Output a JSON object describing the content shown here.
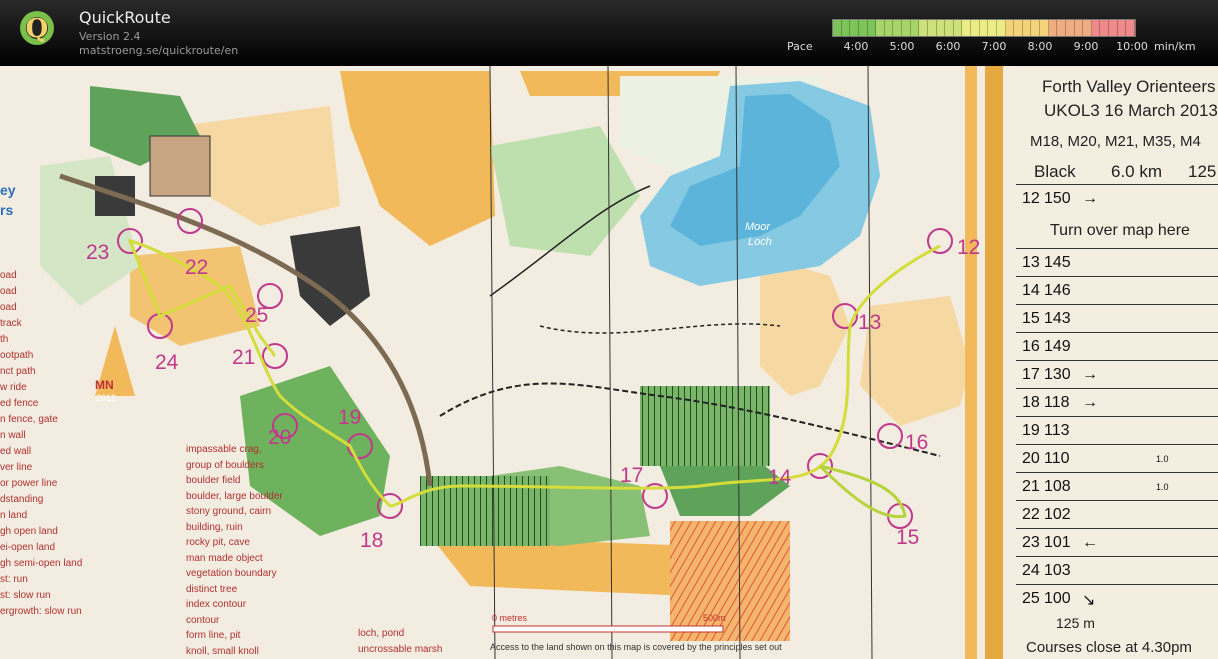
{
  "app": {
    "title": "QuickRoute",
    "version": "Version 2.4",
    "url": "matstroeng.se/quickroute/en",
    "logo_icon": "quickroute-logo-icon"
  },
  "pace": {
    "label": "Pace",
    "ticks": [
      "4:00",
      "5:00",
      "6:00",
      "7:00",
      "8:00",
      "9:00",
      "10:00"
    ],
    "unit": "min/km",
    "colors": [
      "#7cc35a",
      "#a7d56a",
      "#cde07a",
      "#ecec85",
      "#f3d27a",
      "#f0ac82",
      "#f08a8a"
    ]
  },
  "map": {
    "lake_name_1": "Moor",
    "lake_name_2": "Loch",
    "mn_label": "MN",
    "mn_year": "2012",
    "scale_label": "0 metres",
    "scale_end": "500m",
    "access_text": "Access to the land shown on this map is covered by the principles set out",
    "controls": [
      "12",
      "13",
      "14",
      "15",
      "16",
      "17",
      "18",
      "19",
      "20",
      "21",
      "22",
      "23",
      "24",
      "25"
    ],
    "legend_items": [
      "impassable crag,",
      "group of boulders",
      "boulder field",
      "boulder, large boulder",
      "stony ground, cairn",
      "building, ruin",
      "rocky pit, cave",
      "man made object",
      "vegetation boundary",
      "distinct tree",
      "index contour",
      "contour",
      "form line, pit",
      "knoll, small knoll"
    ],
    "legend_items_2": [
      "loch, pond",
      "uncrossable marsh"
    ],
    "left_edge_terms": [
      "oad",
      "oad",
      "oad",
      "track",
      "th",
      "ootpath",
      "nct path",
      "w ride",
      "ed fence",
      "n fence, gate",
      "n wall",
      "ed wall",
      "ver line",
      "or power line",
      "dstanding",
      "n land",
      "gh open land",
      "ei-open land",
      "gh semi-open land",
      "st: run",
      "st: slow run",
      "ergrowth: slow run"
    ],
    "left_edge_title": "ey",
    "left_edge_title2": "rs"
  },
  "control_card": {
    "org": "Forth Valley Orienteers",
    "event": "UKOL3 16 March 2013",
    "classes": "M18, M20, M21, M35, M4",
    "course": "Black",
    "length": "6.0 km",
    "climb": "125",
    "turn_over": "Turn over map here",
    "footer_distance": "125 m",
    "footer_close": "Courses close at 4.30pm",
    "rows": [
      {
        "n": "12",
        "code": "150",
        "extra": "→"
      },
      {
        "n": "13",
        "code": "145",
        "extra": ""
      },
      {
        "n": "14",
        "code": "146",
        "extra": ""
      },
      {
        "n": "15",
        "code": "143",
        "extra": ""
      },
      {
        "n": "16",
        "code": "149",
        "extra": ""
      },
      {
        "n": "17",
        "code": "130",
        "extra": "→"
      },
      {
        "n": "18",
        "code": "118",
        "extra": "→"
      },
      {
        "n": "19",
        "code": "113",
        "extra": ""
      },
      {
        "n": "20",
        "code": "110",
        "extra": "1.0"
      },
      {
        "n": "21",
        "code": "108",
        "extra": "1.0"
      },
      {
        "n": "22",
        "code": "102",
        "extra": ""
      },
      {
        "n": "23",
        "code": "101",
        "extra": "←"
      },
      {
        "n": "24",
        "code": "103",
        "extra": ""
      },
      {
        "n": "25",
        "code": "100",
        "extra": "↘"
      }
    ]
  }
}
